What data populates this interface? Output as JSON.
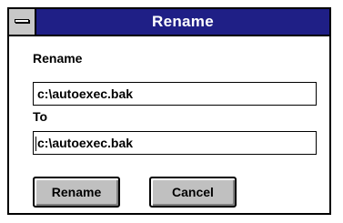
{
  "window": {
    "title": "Rename",
    "system_menu_icon": "window-control-menu-icon"
  },
  "form": {
    "from_label": "Rename",
    "from_value": "c:\\autoexec.bak",
    "to_label": "To",
    "to_value": "c:\\autoexec.bak"
  },
  "buttons": {
    "rename_label": "Rename",
    "cancel_label": "Cancel"
  },
  "colors": {
    "titlebar": "#1f1f86",
    "button_face": "#c0c0c0"
  }
}
